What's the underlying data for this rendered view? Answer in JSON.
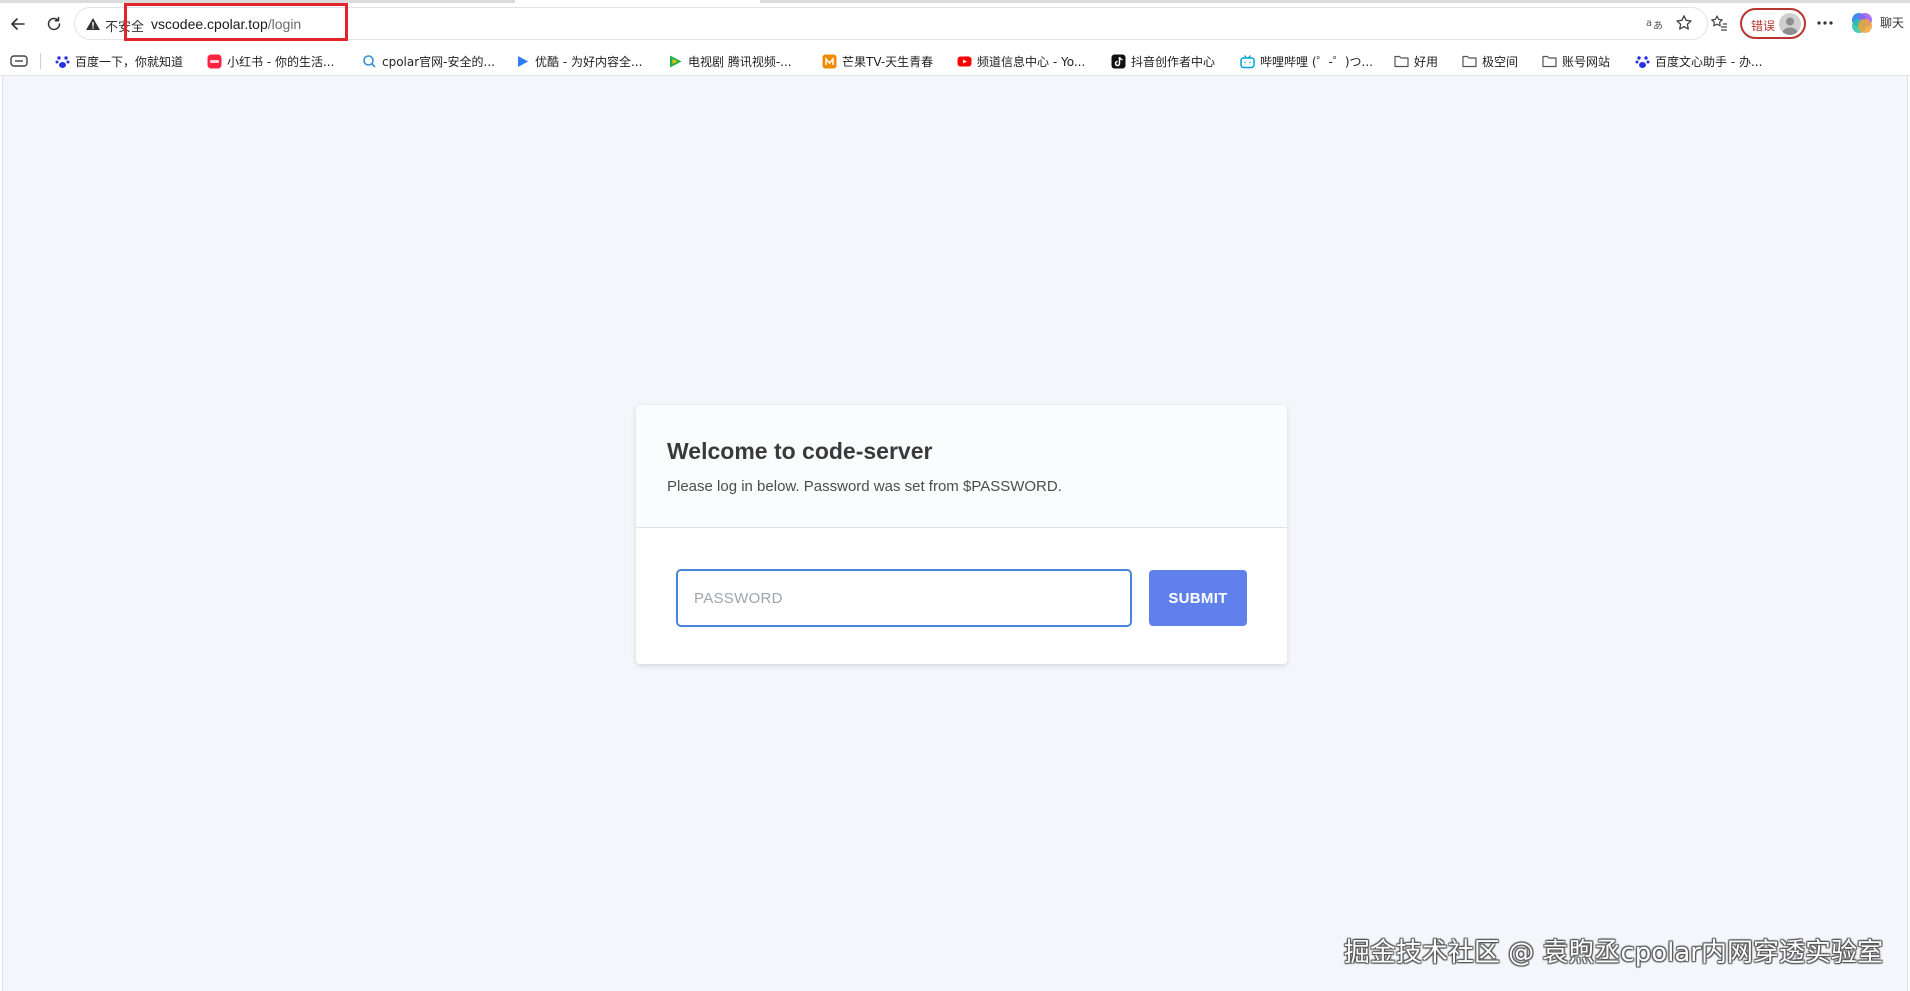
{
  "browser": {
    "insecure_label": "不安全",
    "url_host": "vscodee.cpolar.top",
    "url_path": "/login",
    "error_badge": "错误",
    "copilot_label": "聊天"
  },
  "bookmarks": [
    {
      "label": "百度一下，你就知道",
      "icon": "baidu-paw-icon",
      "color": "#2932e1"
    },
    {
      "label": "小红书 - 你的生活...",
      "icon": "xiaohongshu-icon",
      "color": "#ff2442"
    },
    {
      "label": "cpolar官网-安全的...",
      "icon": "cpolar-search-icon",
      "color": "#3a8fd6"
    },
    {
      "label": "优酷 - 为好内容全...",
      "icon": "youku-play-icon",
      "color": "#2f7df6"
    },
    {
      "label": "电视剧 腾讯视频-...",
      "icon": "tencent-video-icon",
      "color": "#20b14c"
    },
    {
      "label": "芒果TV-天生青春",
      "icon": "mango-tv-icon",
      "color": "#f08a00"
    },
    {
      "label": "频道信息中心 - Yo...",
      "icon": "youtube-icon",
      "color": "#ff0000"
    },
    {
      "label": "抖音创作者中心",
      "icon": "douyin-icon",
      "color": "#111111"
    },
    {
      "label": "哔哩哔哩 (゜-゜)つ...",
      "icon": "bilibili-icon",
      "color": "#00a1d6"
    },
    {
      "label": "好用",
      "icon": "folder-icon",
      "color": "#555555"
    },
    {
      "label": "极空间",
      "icon": "folder-icon",
      "color": "#555555"
    },
    {
      "label": "账号网站",
      "icon": "folder-icon",
      "color": "#555555"
    },
    {
      "label": "百度文心助手 - 办...",
      "icon": "baidu-paw-icon",
      "color": "#2932e1"
    }
  ],
  "login": {
    "title": "Welcome to code-server",
    "subtitle": "Please log in below. Password was set from $PASSWORD.",
    "password_placeholder": "PASSWORD",
    "submit_label": "SUBMIT"
  },
  "watermark": "掘金技术社区 @ 袁煦丞cpolar内网穿透实验室",
  "colors": {
    "page_background": "#f4f6fb",
    "submit_button": "#6080ec",
    "input_focus_border": "#4a86d6",
    "url_highlight_box": "#e0262a"
  }
}
